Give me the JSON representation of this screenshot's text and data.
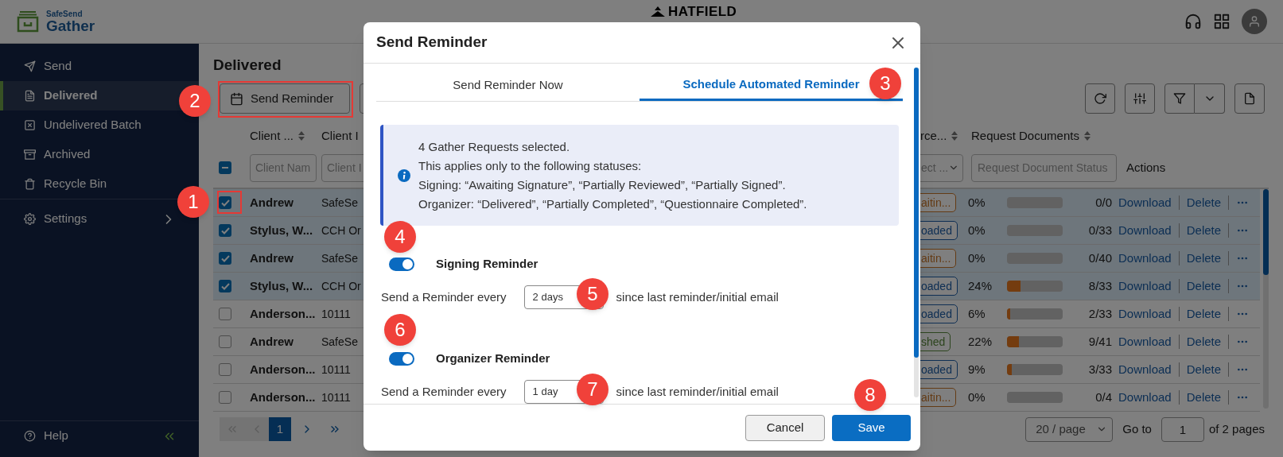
{
  "header": {
    "logo_small": "SafeSend",
    "logo_large": "Gather",
    "org": "HATFIELD"
  },
  "sidebar": {
    "items": [
      {
        "label": "Send",
        "selected": false
      },
      {
        "label": "Delivered",
        "selected": true
      },
      {
        "label": "Undelivered Batch",
        "selected": false
      },
      {
        "label": "Archived",
        "selected": false
      },
      {
        "label": "Recycle Bin",
        "selected": false
      }
    ],
    "settings": "Settings",
    "help": "Help"
  },
  "page": {
    "title": "Delivered",
    "send_reminder_button": "Send Reminder"
  },
  "table": {
    "columns": {
      "client_name": "Client ...",
      "client_id": "Client I",
      "status": "rce...",
      "documents": "Request Documents",
      "actions": "Actions"
    },
    "filters": {
      "client_name": {
        "placeholder": "Client Nam"
      },
      "client_id": {
        "placeholder": "Client I"
      },
      "status": {
        "placeholder": "ect ..."
      },
      "documents": {
        "placeholder": "Request Document Status"
      }
    },
    "select_all_partial": true,
    "rows": [
      {
        "selected": true,
        "name": "Andrew",
        "client_id": "SafeSe",
        "status": {
          "text": "aitin...",
          "kind": "awaiting"
        },
        "percent": "0%",
        "level": 0,
        "count": "0/0",
        "download": "Download",
        "delete": "Delete"
      },
      {
        "selected": true,
        "name": "Stylus, W...",
        "client_id": "CCH Or",
        "status": {
          "text": "oaded",
          "kind": "uploaded"
        },
        "percent": "0%",
        "level": 0,
        "count": "0/33",
        "download": "Download",
        "delete": "Delete"
      },
      {
        "selected": true,
        "name": "Andrew",
        "client_id": "SafeSe",
        "status": {
          "text": "aitin...",
          "kind": "awaiting"
        },
        "percent": "0%",
        "level": 0,
        "count": "0/40",
        "download": "Download",
        "delete": "Delete"
      },
      {
        "selected": true,
        "name": "Stylus, W...",
        "client_id": "CCH Or",
        "status": {
          "text": "oaded",
          "kind": "uploaded"
        },
        "percent": "24%",
        "level": 0.24,
        "count": "8/33",
        "download": "Download",
        "delete": "Delete"
      },
      {
        "selected": false,
        "name": "Anderson...",
        "client_id": "10111",
        "status": {
          "text": "oaded",
          "kind": "uploaded"
        },
        "percent": "6%",
        "level": 0.06,
        "count": "2/33",
        "download": "Download",
        "delete": "Delete"
      },
      {
        "selected": false,
        "name": "Andrew",
        "client_id": "SafeSe",
        "status": {
          "text": "shed",
          "kind": "finished"
        },
        "percent": "22%",
        "level": 0.22,
        "count": "9/41",
        "download": "Download",
        "delete": "Delete"
      },
      {
        "selected": false,
        "name": "Anderson...",
        "client_id": "10111",
        "status": {
          "text": "oaded",
          "kind": "uploaded"
        },
        "percent": "9%",
        "level": 0.09,
        "count": "3/33",
        "download": "Download",
        "delete": "Delete"
      },
      {
        "selected": false,
        "name": "Anderson...",
        "client_id": "10111",
        "status": {
          "text": "aitin...",
          "kind": "awaiting"
        },
        "percent": "0%",
        "level": 0,
        "count": "0/4",
        "download": "Download",
        "delete": "Delete"
      }
    ]
  },
  "pagination": {
    "nav_buttons": [
      {
        "disabled": true
      },
      {
        "disabled": true
      },
      {
        "disabled": false
      },
      {
        "disabled": false
      }
    ],
    "pages": [
      {
        "label": "1",
        "selected": true
      }
    ],
    "page_size": "20 / page",
    "goto_label": "Go to",
    "goto_value": "1",
    "total": "of 2 pages"
  },
  "modal": {
    "title": "Send Reminder",
    "tabs": [
      {
        "label": "Send Reminder Now",
        "selected": false
      },
      {
        "label": "Schedule Automated Reminder",
        "selected": true
      }
    ],
    "info": [
      "4 Gather Requests selected.",
      "This applies only to the following statuses:",
      "Signing: “Awaiting Signature”, “Partially Reviewed”, “Partially Signed”.",
      "Organizer: “Delivered”, “Partially Completed”, “Questionnaire Completed”."
    ],
    "reminders": [
      {
        "title": "Signing Reminder",
        "on": true,
        "prefix": "Send a Reminder every",
        "interval": "2 days",
        "suffix": "since last reminder/initial email"
      },
      {
        "title": "Organizer Reminder",
        "on": true,
        "prefix": "Send a Reminder every",
        "interval": "1 day",
        "suffix": "since last reminder/initial email"
      }
    ],
    "buttons": {
      "cancel": "Cancel",
      "save": "Save"
    }
  },
  "callouts": [
    {
      "number": "1"
    },
    {
      "number": "2"
    },
    {
      "number": "3"
    },
    {
      "number": "4"
    },
    {
      "number": "5"
    },
    {
      "number": "6"
    },
    {
      "number": "7"
    },
    {
      "number": "8"
    }
  ]
}
